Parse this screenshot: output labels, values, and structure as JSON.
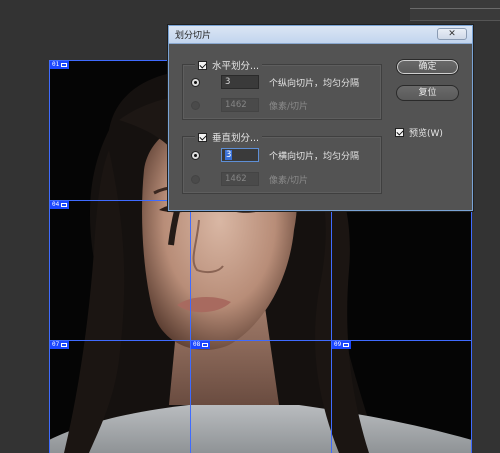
{
  "dialog": {
    "title": "划分切片",
    "close_icon": "close-icon",
    "horizontal": {
      "checkbox_label": "水平划分...",
      "checked": true,
      "count_value": "3",
      "count_suffix": "个纵向切片，均匀分隔",
      "pixel_value": "1462",
      "pixel_suffix": "像素/切片"
    },
    "vertical": {
      "checkbox_label": "垂直划分...",
      "checked": true,
      "count_value": "3",
      "count_suffix": "个横向切片，均匀分隔",
      "pixel_value": "1462",
      "pixel_suffix": "像素/切片"
    },
    "ok_label": "确定",
    "reset_label": "复位",
    "preview_label": "预览(W)",
    "preview_checked": true
  },
  "slices": {
    "labels": [
      "01",
      "04",
      "07",
      "08",
      "09"
    ],
    "line_color": "#3f6bff",
    "label_color": "#1c47ff"
  }
}
